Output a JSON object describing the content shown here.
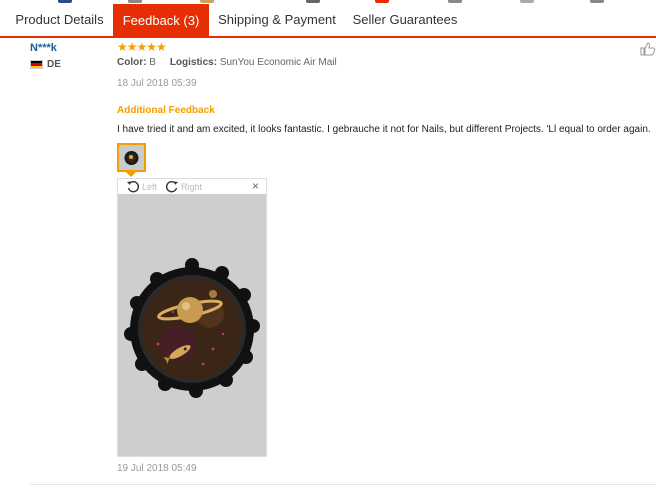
{
  "tabs": [
    {
      "label": "Product Details",
      "active": false
    },
    {
      "label": "Feedback (3)",
      "active": true
    },
    {
      "label": "Shipping & Payment",
      "active": false
    },
    {
      "label": "Seller Guarantees",
      "active": false
    }
  ],
  "colors": {
    "accent": "#e62e04",
    "star": "#f59d00",
    "user_link": "#1b5e99"
  },
  "review": {
    "user": "N***k",
    "country_code": "DE",
    "rating_stars": 5,
    "stars_text": "★★★★★",
    "color_label": "Color:",
    "color_value": "B",
    "logistics_label": "Logistics:",
    "logistics_value": "SunYou Economic Air Mail",
    "date": "18 Jul 2018 05:39",
    "additional_title": "Additional Feedback",
    "additional_text": "I have tried it and am excited, it looks fantastic. I gebrauche it not for Nails, but different Projects. 'Ll equal to order again.",
    "additional_date": "19 Jul 2018 05:49"
  },
  "viewer": {
    "rotate_left_label": "Left",
    "rotate_right_label": "Right",
    "close_glyph": "×"
  },
  "icons": {
    "helpful": "thumbs-up-icon",
    "rotate_left": "rotate-left-icon",
    "rotate_right": "rotate-right-icon",
    "close": "close-icon",
    "flag": "germany-flag-icon"
  }
}
